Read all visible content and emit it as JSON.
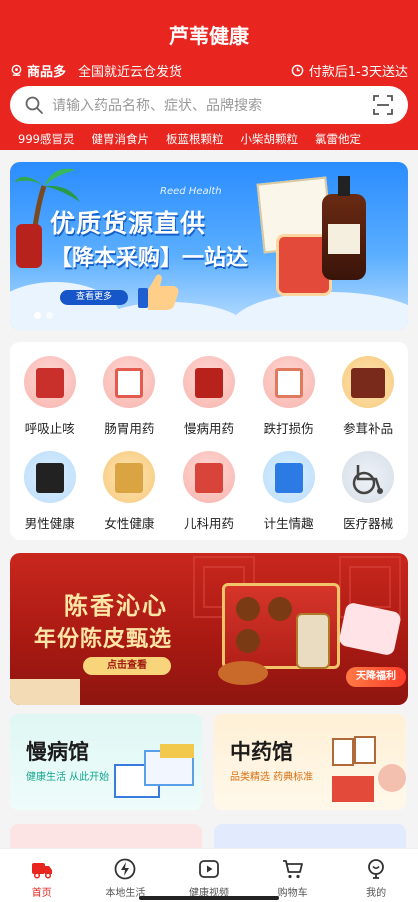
{
  "app": {
    "title": "芦苇健康"
  },
  "info": {
    "location_icon": "location-pin-icon",
    "highlight": "商品多",
    "shipping_note": "全国就近云仓发货",
    "clock_icon": "clock-icon",
    "delivery_note": "付款后1-3天送达"
  },
  "search": {
    "placeholder": "请输入药品名称、症状、品牌搜索",
    "search_icon": "search-icon",
    "scan_icon": "scan-icon"
  },
  "hot_keywords": [
    "999感冒灵",
    "健胃消食片",
    "板蓝根颗粒",
    "小柴胡颗粒",
    "氯雷他定"
  ],
  "banner": {
    "brand": "Reed Health",
    "title": "优质货源直供",
    "subtitle": "【降本采购】一站达",
    "button": "查看更多",
    "slide_count": 2,
    "active_slide": 1
  },
  "categories": [
    {
      "label": "呼吸止咳",
      "color": "#c9302c"
    },
    {
      "label": "肠胃用药",
      "color": "#e25b4e"
    },
    {
      "label": "慢病用药",
      "color": "#b8221c"
    },
    {
      "label": "跌打损伤",
      "color": "#e07a5f"
    },
    {
      "label": "参茸补品",
      "color": "#7a2a1a"
    },
    {
      "label": "男性健康",
      "color": "#222222"
    },
    {
      "label": "女性健康",
      "color": "#d9a441"
    },
    {
      "label": "儿科用药",
      "color": "#d8433a"
    },
    {
      "label": "计生情趣",
      "color": "#2c7be5"
    },
    {
      "label": "医疗器械",
      "color": "#555555"
    }
  ],
  "promo": {
    "line1": "陈香沁心",
    "line2": "年份陈皮甄选",
    "button": "点击查看",
    "badge": "天降福利"
  },
  "tiles": [
    {
      "title": "慢病馆",
      "subtitle": "健康生活 从此开始"
    },
    {
      "title": "中药馆",
      "subtitle": "品类精选 药典标准"
    }
  ],
  "tabbar": [
    {
      "label": "首页",
      "icon": "home-truck-icon",
      "active": true
    },
    {
      "label": "本地生活",
      "icon": "lightning-icon",
      "active": false
    },
    {
      "label": "健康视频",
      "icon": "play-icon",
      "active": false
    },
    {
      "label": "购物车",
      "icon": "cart-icon",
      "active": false
    },
    {
      "label": "我的",
      "icon": "profile-icon",
      "active": false
    }
  ],
  "colors": {
    "brand": "#e8251f",
    "banner_blue": "#2a8cff",
    "promo_red": "#a71912"
  }
}
